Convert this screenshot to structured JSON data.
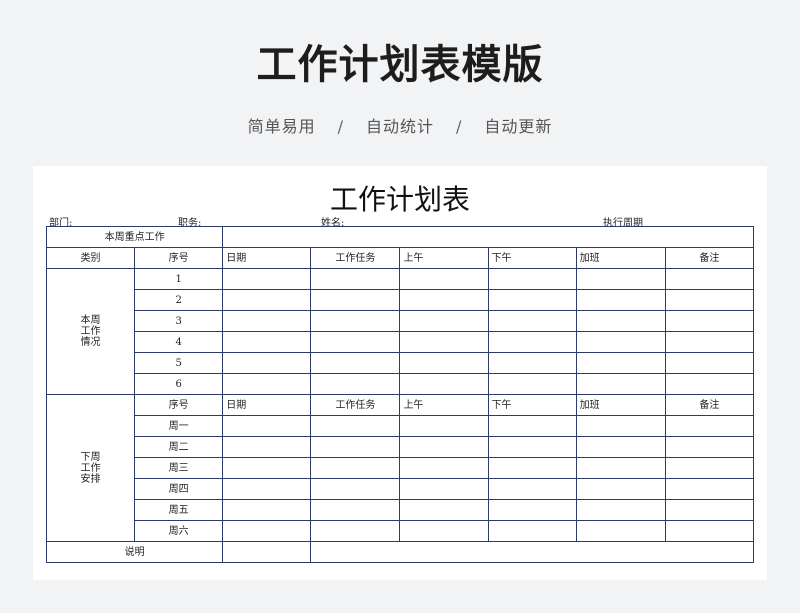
{
  "hero": {
    "title": "工作计划表模版",
    "features": [
      "简单易用",
      "自动统计",
      "自动更新"
    ],
    "separator": "/"
  },
  "document": {
    "title": "工作计划表",
    "meta": {
      "department": "部门:",
      "position": "职务:",
      "name": "姓名:",
      "execution_period": "执行周期"
    },
    "key_work_label": "本周重点工作",
    "category_header": "类别",
    "this_week": {
      "label_lines": [
        "本周",
        "工作",
        "情况"
      ],
      "columns": [
        "序号",
        "日期",
        "工作任务",
        "上午",
        "下午",
        "加班",
        "备注"
      ],
      "rows": [
        "1",
        "2",
        "3",
        "4",
        "5",
        "6"
      ]
    },
    "next_week": {
      "label_lines": [
        "下周",
        "工作",
        "安排"
      ],
      "columns": [
        "序号",
        "日期",
        "工作任务",
        "上午",
        "下午",
        "加班",
        "备注"
      ],
      "rows": [
        "周一",
        "周二",
        "周三",
        "周四",
        "周五",
        "周六"
      ]
    },
    "notes_label": "说明"
  }
}
